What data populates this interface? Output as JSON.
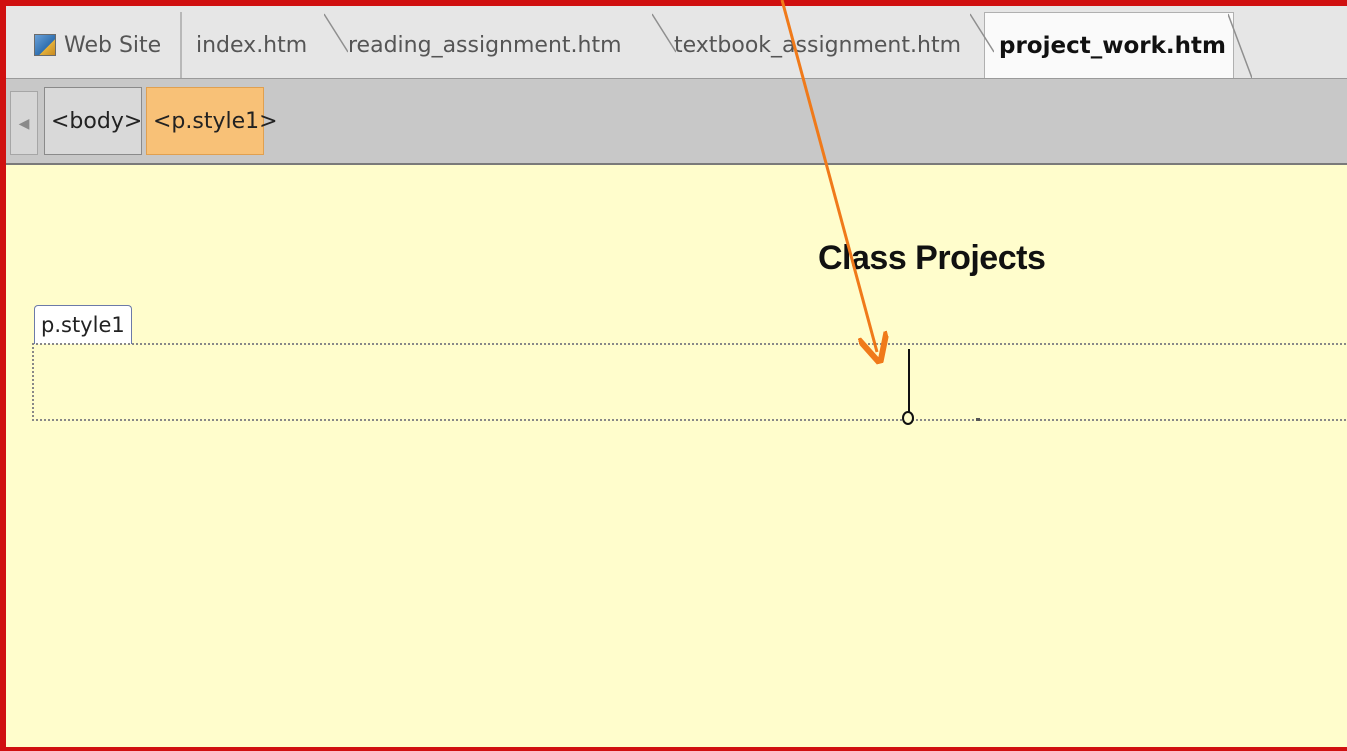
{
  "tabs": [
    {
      "label": "Web Site",
      "icon": "globe-icon",
      "active": false
    },
    {
      "label": "index.htm",
      "active": false
    },
    {
      "label": "reading_assignment.htm",
      "active": false
    },
    {
      "label": "textbook_assignment.htm",
      "active": false
    },
    {
      "label": "project_work.htm",
      "active": true
    }
  ],
  "breadcrumb": {
    "items": [
      "<body>",
      "<p.style1>"
    ],
    "selected": "<p.style1>"
  },
  "page": {
    "heading": "Class Projects",
    "paragraph_tag": "p.style1",
    "paragraph_text": ""
  },
  "annotation": {
    "type": "arrow",
    "color": "#f07a1a"
  },
  "colors": {
    "window_border": "#d01010",
    "design_background": "#fffdcc",
    "selected_crumb": "#f8c177",
    "arrow": "#f07a1a"
  }
}
